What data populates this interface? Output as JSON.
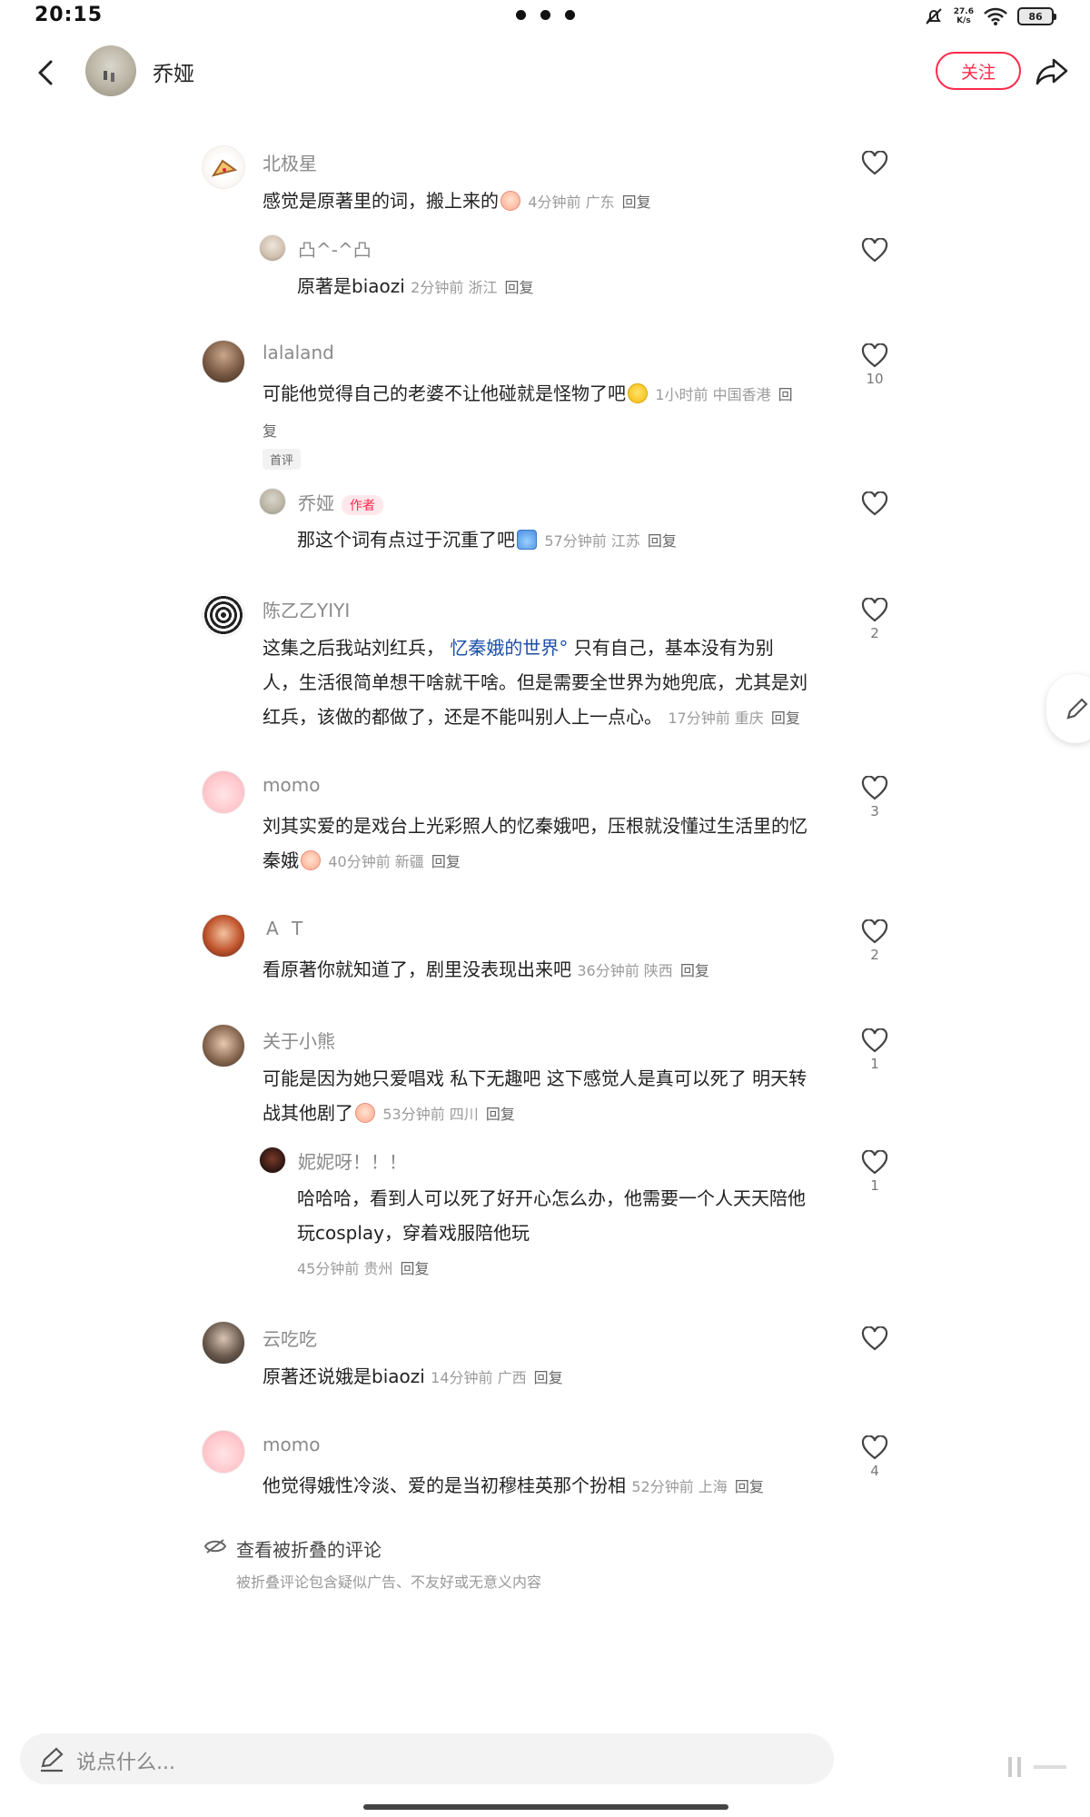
{
  "status": {
    "time": "20:15",
    "net_speed_top": "27.6",
    "net_speed_bottom": "K/s",
    "battery": "86"
  },
  "header": {
    "title": "乔娅",
    "follow_label": "关注"
  },
  "comments": [
    {
      "user": "北极星",
      "text": "感觉是原著里的词，搬上来的",
      "meta": "4分钟前 广东",
      "reply": "回复",
      "likes": "",
      "emoji": "cry"
    },
    {
      "user": "凸^-^凸",
      "text": "原著是biaozi",
      "meta": "2分钟前 浙江",
      "reply": "回复",
      "likes": ""
    },
    {
      "user": "lalaland",
      "text": "可能他觉得自己的老婆不让他碰就是怪物了吧",
      "meta": "1小时前 中国香港",
      "reply": "回",
      "reply_wrap": "复",
      "tag": "首评",
      "likes": "10",
      "emoji": "sweat"
    },
    {
      "user": "乔娅",
      "author_tag": "作者",
      "text": "那这个词有点过于沉重了吧",
      "meta": "57分钟前 江苏",
      "reply": "回复",
      "likes": "",
      "emoji": "cake"
    },
    {
      "user": "陈乙乙YIYI",
      "text_1a": "这集之后我站刘红兵，",
      "link": "忆秦娥的世界",
      "text_1b": "只有自己，基本没有为别",
      "text_2": "人，生活很简单想干啥就干啥。但是需要全世界为她兜底，尤其是刘",
      "text_3": "红兵，该做的都做了，还是不能叫别人上一点心。",
      "meta": "17分钟前 重庆",
      "reply": "回复",
      "likes": "2"
    },
    {
      "user": "momo",
      "text_1": "刘其实爱的是戏台上光彩照人的忆秦娥吧，压根就没懂过生活里的忆",
      "text_2": "秦娥",
      "meta": "40分钟前 新疆",
      "reply": "回复",
      "likes": "3",
      "emoji": "cry"
    },
    {
      "user": "A T",
      "text": "看原著你就知道了，剧里没表现出来吧",
      "meta": "36分钟前 陕西",
      "reply": "回复",
      "likes": "2"
    },
    {
      "user": "关于小熊",
      "text_1": "可能是因为她只爱唱戏 私下无趣吧  这下感觉人是真可以死了 明天转",
      "text_2": "战其他剧了",
      "meta": "53分钟前 四川",
      "reply": "回复",
      "likes": "1",
      "emoji": "cry"
    },
    {
      "user": "妮妮呀！！！",
      "text_1": "哈哈哈，看到人可以死了好开心怎么办，他需要一个人天天陪他",
      "text_2": "玩cosplay，穿着戏服陪他玩",
      "meta": "45分钟前 贵州",
      "reply": "回复",
      "likes": "1"
    },
    {
      "user": "云吃吃",
      "text": "原著还说娥是biaozi",
      "meta": "14分钟前 广西",
      "reply": "回复",
      "likes": ""
    },
    {
      "user": "momo",
      "text": "他觉得娥性冷淡、爱的是当初穆桂英那个扮相",
      "meta": "52分钟前 上海",
      "reply": "回复",
      "likes": "4"
    }
  ],
  "folded": {
    "title": "查看被折叠的评论",
    "subtitle": "被折叠评论包含疑似广告、不友好或无意义内容"
  },
  "input": {
    "placeholder": "说点什么..."
  },
  "colors": {
    "accent": "#ff2a4c",
    "link": "#1d4fa8",
    "meta": "#9b9b9b"
  }
}
